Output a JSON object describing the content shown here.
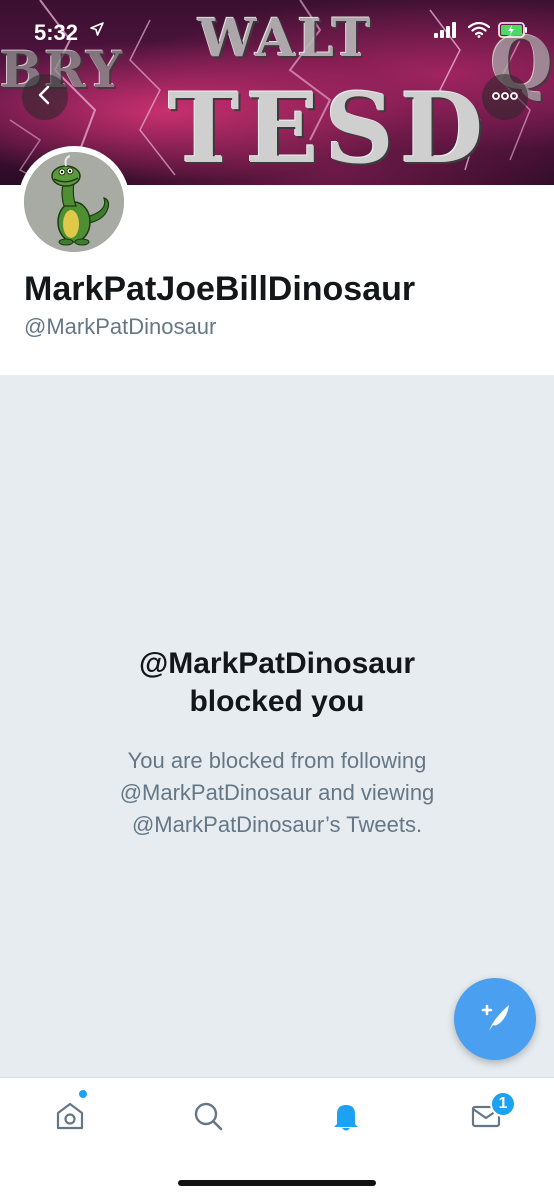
{
  "status_bar": {
    "time": "5:32"
  },
  "banner": {
    "line1": "WALT",
    "line2": "BRY",
    "line3": "TESD",
    "line4": "Q"
  },
  "profile": {
    "display_name": "MarkPatJoeBillDinosaur",
    "handle": "@MarkPatDinosaur"
  },
  "blocked": {
    "title_line1": "@MarkPatDinosaur",
    "title_line2": "blocked you",
    "desc_line1": "You are blocked from following",
    "desc_line2": "@MarkPatDinosaur and viewing",
    "desc_line3": "@MarkPatDinosaur’s Tweets."
  },
  "tabs": {
    "messages_badge": "1"
  },
  "icons": {
    "back": "back-arrow-icon",
    "more": "more-options-icon",
    "compose": "compose-tweet-icon",
    "home": "home-icon",
    "search": "search-icon",
    "notifications": "bell-icon",
    "messages": "envelope-icon"
  },
  "colors": {
    "accent": "#1da1f2",
    "fab": "#4a9ff0",
    "blocked_bg": "#e6ecf0",
    "secondary_text": "#657786",
    "primary_text": "#14171a"
  }
}
